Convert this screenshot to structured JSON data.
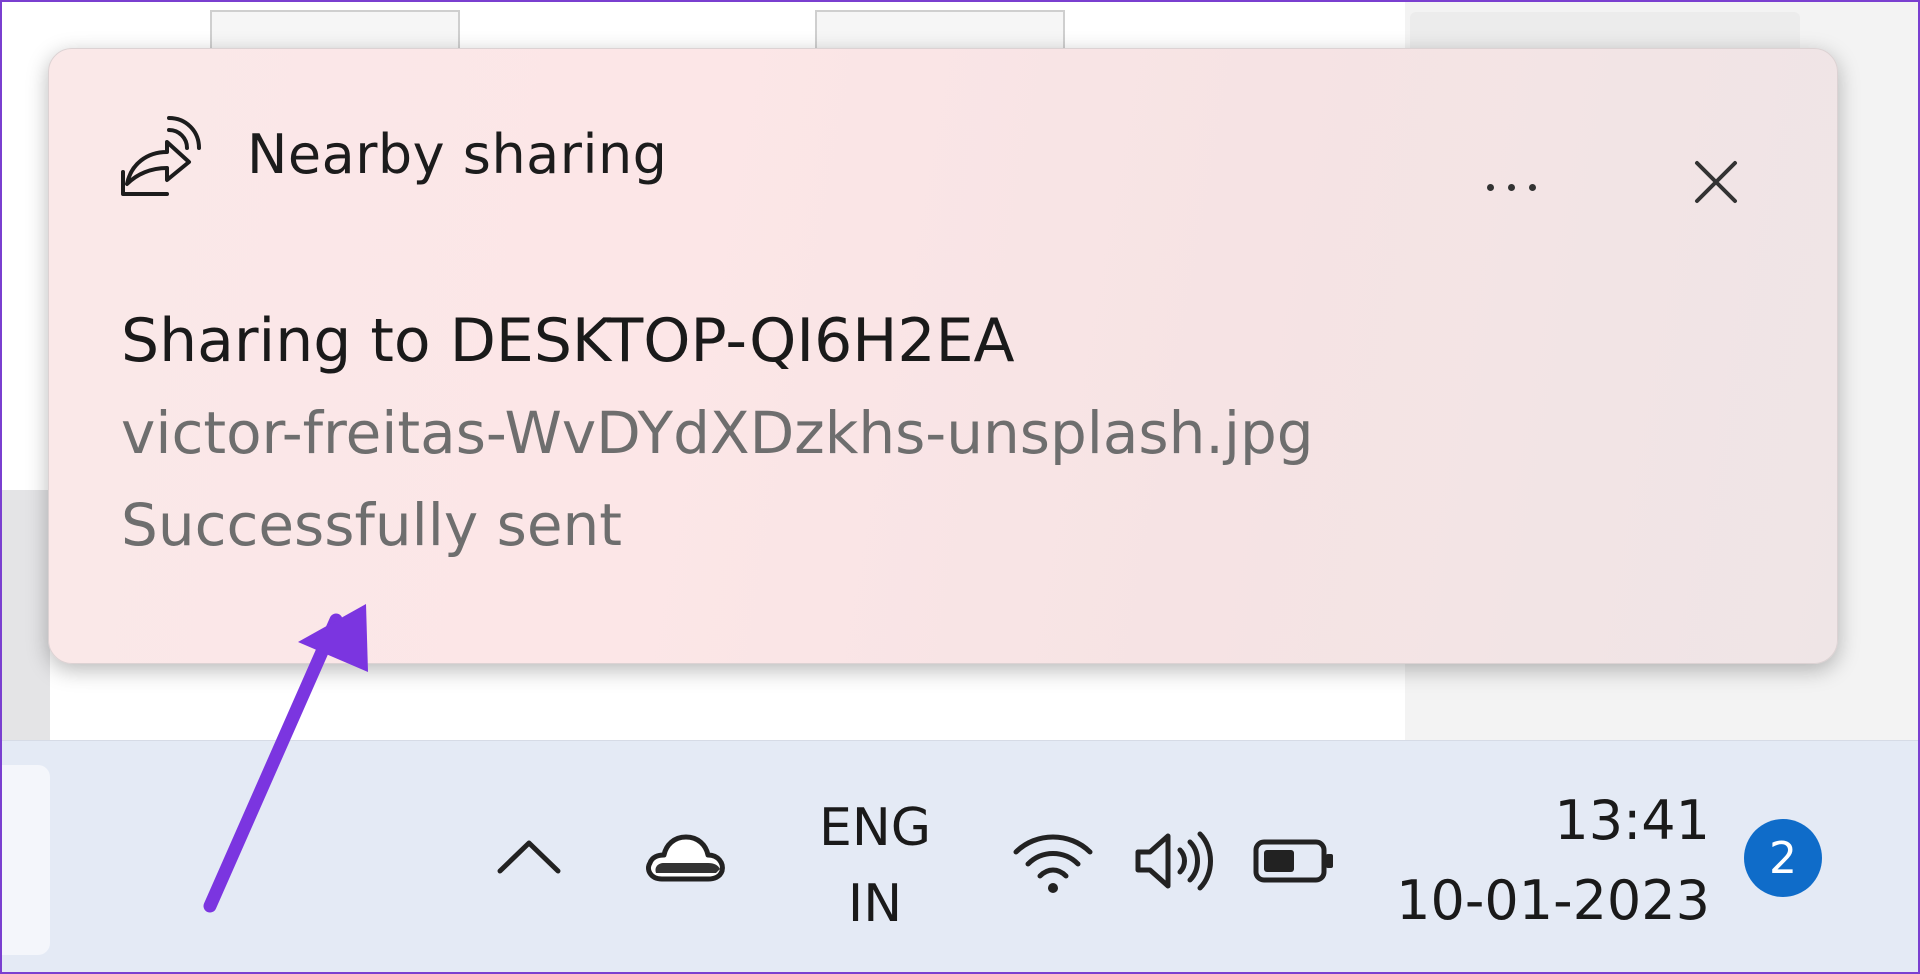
{
  "toast": {
    "app_name": "Nearby sharing",
    "app_icon": "nearby-share-icon",
    "more_icon": "more-options-icon",
    "close_icon": "close-icon",
    "title": "Sharing to DESKTOP-QI6H2EA",
    "file_name": "victor-freitas-WvDYdXDzkhs-unsplash.jpg",
    "status": "Successfully sent"
  },
  "taskbar": {
    "tray": {
      "overflow_icon": "chevron-up-icon",
      "cloud_icon": "onedrive-cloud-icon",
      "wifi_icon": "wifi-icon",
      "volume_icon": "volume-icon",
      "battery_icon": "battery-icon"
    },
    "language": {
      "line1": "ENG",
      "line2": "IN"
    },
    "clock": {
      "time": "13:41",
      "date": "10-01-2023"
    },
    "notification_count": "2"
  },
  "colors": {
    "accent_badge": "#0f6cc9",
    "annotation_arrow": "#7b35e0",
    "toast_bg": "#fce6e7",
    "taskbar_bg": "#e4eaf5"
  }
}
